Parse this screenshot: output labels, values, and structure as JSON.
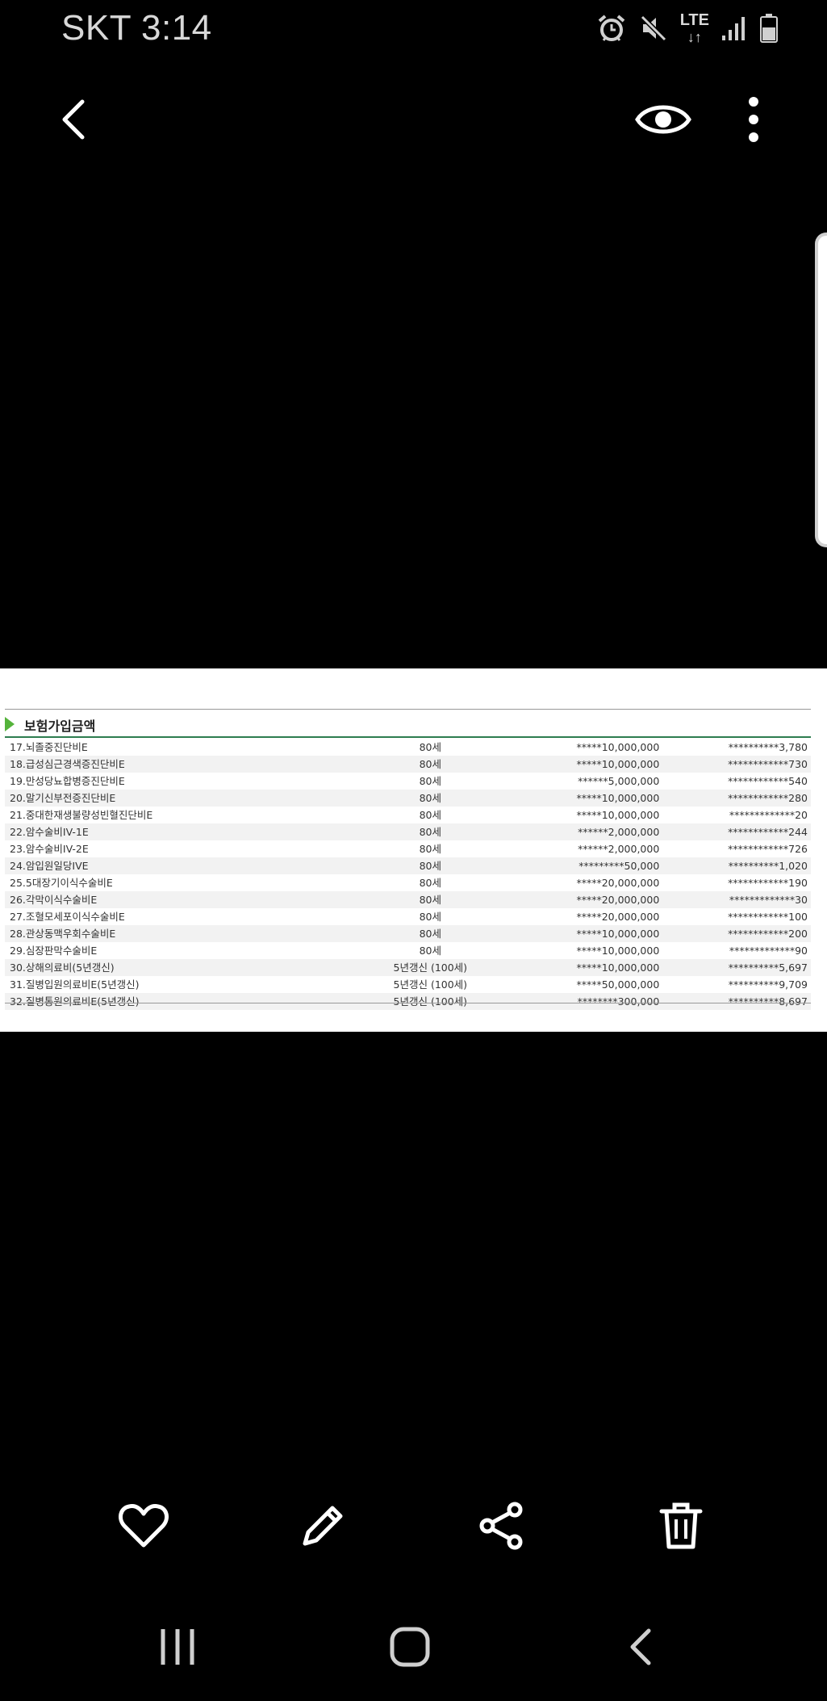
{
  "status_bar": {
    "carrier_time": "SKT 3:14",
    "network": "LTE",
    "network_arrows": "↓↑",
    "icons": [
      "alarm-icon",
      "mute-icon",
      "lte-icon",
      "signal-icon",
      "battery-icon"
    ]
  },
  "top_bar": {
    "icons": [
      "back-arrow-icon",
      "eye-icon",
      "more-vert-icon"
    ]
  },
  "document": {
    "title": "보험가입금액",
    "accent_color": "#55b33b",
    "rows": [
      {
        "name": "17.뇌졸중진단비E",
        "period": "80세",
        "amount": "*****10,000,000",
        "premium": "**********3,780"
      },
      {
        "name": "18.급성심근경색증진단비E",
        "period": "80세",
        "amount": "*****10,000,000",
        "premium": "************730"
      },
      {
        "name": "19.만성당뇨합병증진단비E",
        "period": "80세",
        "amount": "******5,000,000",
        "premium": "************540"
      },
      {
        "name": "20.말기신부전증진단비E",
        "period": "80세",
        "amount": "*****10,000,000",
        "premium": "************280"
      },
      {
        "name": "21.중대한재생불량성빈혈진단비E",
        "period": "80세",
        "amount": "*****10,000,000",
        "premium": "*************20"
      },
      {
        "name": "22.암수술비IV-1E",
        "period": "80세",
        "amount": "******2,000,000",
        "premium": "************244"
      },
      {
        "name": "23.암수술비IV-2E",
        "period": "80세",
        "amount": "******2,000,000",
        "premium": "************726"
      },
      {
        "name": "24.암입원일당IVE",
        "period": "80세",
        "amount": "*********50,000",
        "premium": "**********1,020"
      },
      {
        "name": "25.5대장기이식수술비E",
        "period": "80세",
        "amount": "*****20,000,000",
        "premium": "************190"
      },
      {
        "name": "26.각막이식수술비E",
        "period": "80세",
        "amount": "*****20,000,000",
        "premium": "*************30"
      },
      {
        "name": "27.조혈모세포이식수술비E",
        "period": "80세",
        "amount": "*****20,000,000",
        "premium": "************100"
      },
      {
        "name": "28.관상동맥우회수술비E",
        "period": "80세",
        "amount": "*****10,000,000",
        "premium": "************200"
      },
      {
        "name": "29.심장판막수술비E",
        "period": "80세",
        "amount": "*****10,000,000",
        "premium": "*************90"
      },
      {
        "name": "30.상해의료비(5년갱신)",
        "period": "5년갱신 (100세)",
        "amount": "*****10,000,000",
        "premium": "**********5,697"
      },
      {
        "name": "31.질병입원의료비E(5년갱신)",
        "period": "5년갱신 (100세)",
        "amount": "*****50,000,000",
        "premium": "**********9,709"
      },
      {
        "name": "32.질병통원의료비E(5년갱신)",
        "period": "5년갱신 (100세)",
        "amount": "********300,000",
        "premium": "**********8,697"
      }
    ]
  },
  "action_bar": {
    "icons": [
      "heart-icon",
      "edit-pencil-icon",
      "share-icon",
      "trash-icon"
    ]
  },
  "nav_bar": {
    "icons": [
      "recent-apps-icon",
      "home-icon",
      "back-icon"
    ]
  }
}
